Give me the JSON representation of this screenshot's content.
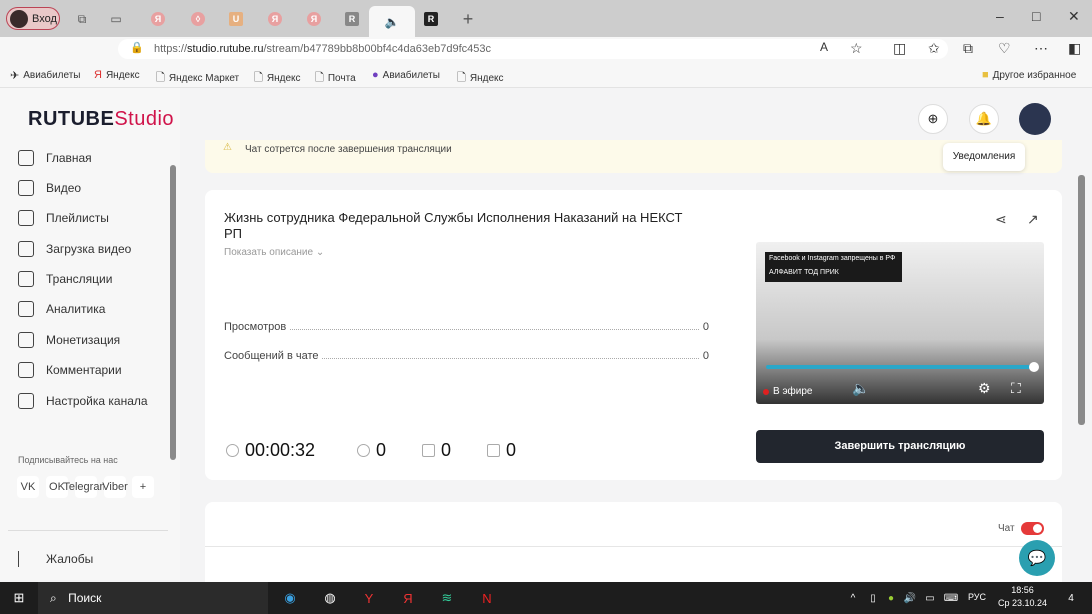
{
  "browser": {
    "profile_label": "Вход",
    "url_prefix": "https://",
    "url_domain": "studio.rutube.ru",
    "url_path": "/stream/b47789bb8b00bf4c4da63eb7d9fc453c",
    "bookmarks": [
      "Авиабилеты",
      "Яндекс",
      "Яндекс Маркет",
      "Яндекс",
      "Почта",
      "Авиабилеты",
      "Яндекс"
    ],
    "other_favorites": "Другое избранное"
  },
  "logo": {
    "main": "RUTUBE",
    "sub": "Studio"
  },
  "sidebar": {
    "items": [
      {
        "label": "Главная",
        "icon": "home-icon"
      },
      {
        "label": "Видео",
        "icon": "video-icon"
      },
      {
        "label": "Плейлисты",
        "icon": "playlist-icon"
      },
      {
        "label": "Загрузка видео",
        "icon": "upload-icon"
      },
      {
        "label": "Трансляции",
        "icon": "broadcast-icon"
      },
      {
        "label": "Аналитика",
        "icon": "analytics-icon"
      },
      {
        "label": "Монетизация",
        "icon": "monetization-icon"
      },
      {
        "label": "Комментарии",
        "icon": "comments-icon"
      },
      {
        "label": "Настройка канала",
        "icon": "settings-icon"
      }
    ],
    "follow_label": "Подписывайтесь на нас",
    "socials": [
      "VK",
      "OK",
      "Telegram",
      "Viber",
      "+"
    ],
    "complaints": "Жалобы"
  },
  "header": {
    "tooltip": "Уведомления"
  },
  "warning": "Чат сотрется после завершения трансляции",
  "stream": {
    "title": "Жизнь сотрудника Федеральной Службы Исполнения Наказаний на НЕКСТ РП",
    "show_description": "Показать описание",
    "stats": [
      {
        "label": "Просмотров",
        "value": "0"
      },
      {
        "label": "Сообщений в чате",
        "value": "0"
      }
    ],
    "duration": "00:00:32",
    "viewers": "0",
    "likes": "0",
    "dislikes": "0",
    "player": {
      "overlay_text": "Facebook и Instagram запрещены в РФ",
      "overlay_sub": "АЛФАВИТ ТОД ПРИК",
      "live_label": "В эфире",
      "progress": 1.0
    },
    "end_button": "Завершить трансляцию"
  },
  "chat": {
    "label": "Чат",
    "enabled": true
  },
  "taskbar": {
    "search": "Поиск",
    "lang": "РУС",
    "time": "18:56",
    "date": "Ср 23.10.24",
    "notifications": "4"
  }
}
